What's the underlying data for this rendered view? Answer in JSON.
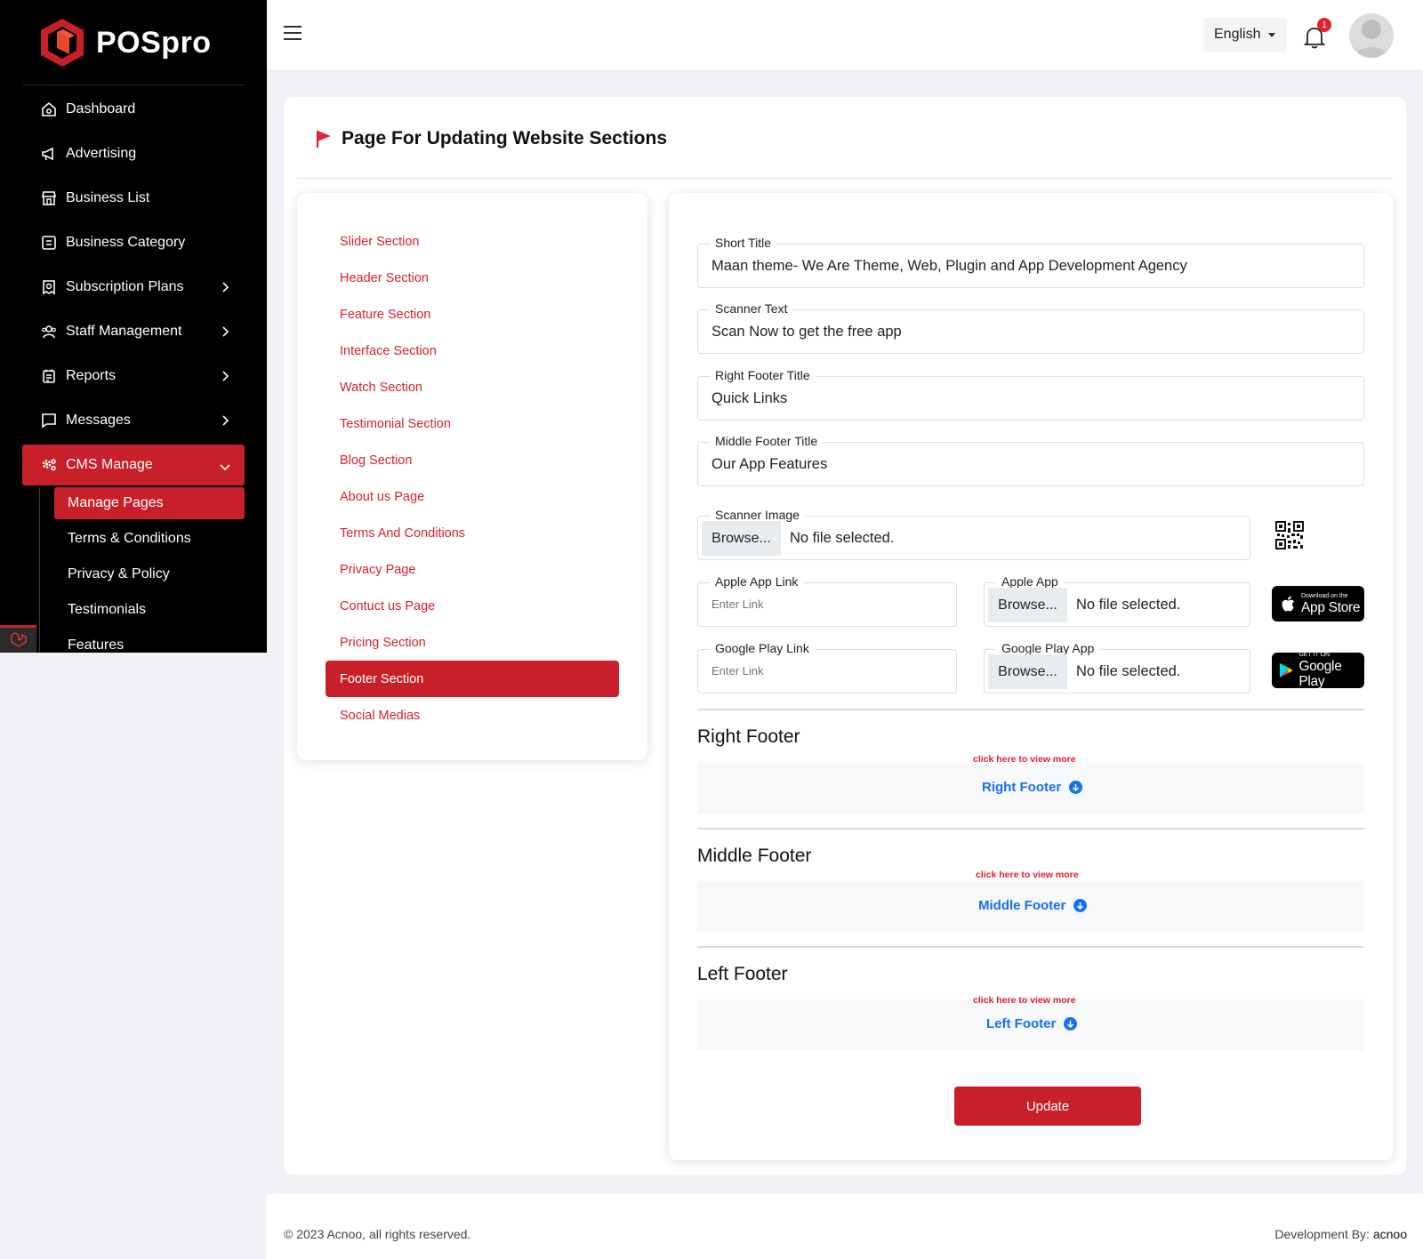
{
  "brand": {
    "name": "POSpro",
    "accent": "#c8202a"
  },
  "sidebar": {
    "items": [
      {
        "label": "Dashboard",
        "icon": "home-icon"
      },
      {
        "label": "Advertising",
        "icon": "megaphone-icon"
      },
      {
        "label": "Business List",
        "icon": "store-icon"
      },
      {
        "label": "Business Category",
        "icon": "category-icon"
      },
      {
        "label": "Subscription Plans",
        "icon": "plan-icon",
        "has_children": true
      },
      {
        "label": "Staff Management",
        "icon": "users-icon",
        "has_children": true
      },
      {
        "label": "Reports",
        "icon": "report-icon",
        "has_children": true
      },
      {
        "label": "Messages",
        "icon": "message-icon",
        "has_children": true
      },
      {
        "label": "CMS Manage",
        "icon": "gears-icon",
        "has_children": true,
        "active": true
      }
    ],
    "cms_sub": [
      {
        "label": "Manage Pages",
        "active": true
      },
      {
        "label": "Terms & Conditions"
      },
      {
        "label": "Privacy & Policy"
      },
      {
        "label": "Testimonials"
      },
      {
        "label": "Features"
      }
    ]
  },
  "topbar": {
    "language": "English",
    "notification_count": "1"
  },
  "page": {
    "title": "Page For Updating Website Sections"
  },
  "sections_menu": [
    "Slider Section",
    "Header Section",
    "Feature Section",
    "Interface Section",
    "Watch Section",
    "Testimonial Section",
    "Blog Section",
    "About us Page",
    "Terms And Conditions",
    "Privacy Page",
    "Contuct us Page",
    "Pricing Section",
    "Footer Section",
    "Social Medias"
  ],
  "sections_menu_active": "Footer Section",
  "form": {
    "short_title": {
      "label": "Short Title",
      "value": "Maan theme- We Are Theme, Web, Plugin and App Development Agency"
    },
    "scanner_text": {
      "label": "Scanner Text",
      "value": "Scan Now to get the free app"
    },
    "right_footer_title": {
      "label": "Right Footer Title",
      "value": "Quick Links"
    },
    "middle_footer_title": {
      "label": "Middle Footer Title",
      "value": "Our App Features"
    },
    "scanner_image": {
      "label": "Scanner Image",
      "browse": "Browse...",
      "status": "No file selected."
    },
    "apple_app_link": {
      "label": "Apple App Link",
      "placeholder": "Enter Link"
    },
    "apple_app": {
      "label": "Apple App",
      "browse": "Browse...",
      "status": "No file selected."
    },
    "google_play_link": {
      "label": "Google Play Link",
      "placeholder": "Enter Link"
    },
    "google_play_app": {
      "label": "Google Play App",
      "browse": "Browse...",
      "status": "No file selected."
    },
    "app_store_badge": {
      "small": "Download on the",
      "big": "App Store"
    },
    "google_play_badge": {
      "small": "GET IT ON",
      "big": "Google Play"
    },
    "footers": [
      {
        "title": "Right Footer",
        "hint": "click here to view more",
        "link": "Right Footer"
      },
      {
        "title": "Middle Footer",
        "hint": "click here to view more",
        "link": "Middle Footer"
      },
      {
        "title": "Left Footer",
        "hint": "click here to view more",
        "link": "Left Footer"
      }
    ],
    "update_label": "Update"
  },
  "footer": {
    "copyright": "© 2023 Acnoo, all rights reserved.",
    "dev_prefix": "Development By: ",
    "dev_name": "acnoo"
  }
}
